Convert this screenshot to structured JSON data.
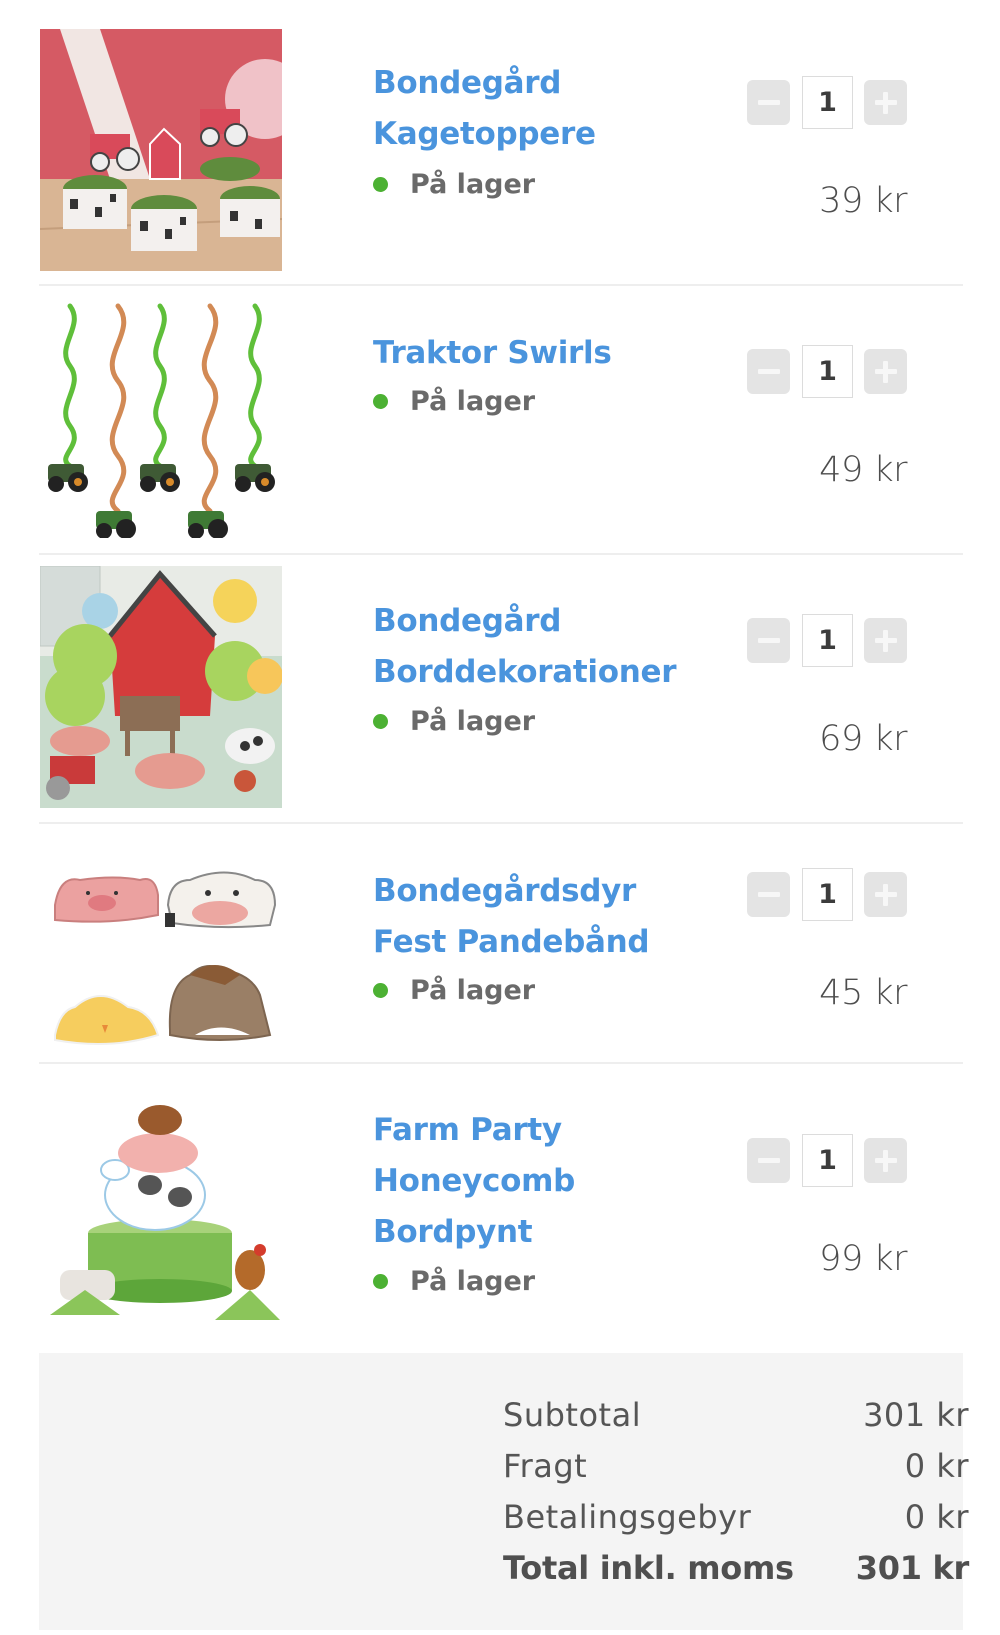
{
  "cart": {
    "items": [
      {
        "title_lines": [
          "Bondegård",
          "Kagetoppere"
        ],
        "stock": "På lager",
        "quantity": "1",
        "price": "39 kr",
        "image": "cupcake-toppers-photo"
      },
      {
        "title_lines": [
          "Traktor Swirls"
        ],
        "stock": "På lager",
        "quantity": "1",
        "price": "49 kr",
        "image": "tractor-swirls-photo"
      },
      {
        "title_lines": [
          "Bondegård",
          "Borddekorationer"
        ],
        "stock": "På lager",
        "quantity": "1",
        "price": "69 kr",
        "image": "farm-table-decorations-photo"
      },
      {
        "title_lines": [
          "Bondegårdsdyr",
          "Fest Pandebånd"
        ],
        "stock": "På lager",
        "quantity": "1",
        "price": "45 kr",
        "image": "farm-animal-headbands-photo"
      },
      {
        "title_lines": [
          "Farm Party",
          "Honeycomb",
          "Bordpynt"
        ],
        "stock": "På lager",
        "quantity": "1",
        "price": "99 kr",
        "image": "honeycomb-centerpiece-photo"
      }
    ],
    "stepper": {
      "minus_icon": "minus-icon",
      "plus_icon": "plus-icon"
    }
  },
  "summary": {
    "subtotal_label": "Subtotal",
    "subtotal_value": "301 kr",
    "shipping_label": "Fragt",
    "shipping_value": "0 kr",
    "fee_label": "Betalingsgebyr",
    "fee_value": "0 kr",
    "total_label": "Total inkl. moms",
    "total_value": "301 kr"
  },
  "colors": {
    "title_blue": "#4a94dd",
    "in_stock_green": "#4cb133",
    "summary_bg": "#f4f4f4"
  }
}
